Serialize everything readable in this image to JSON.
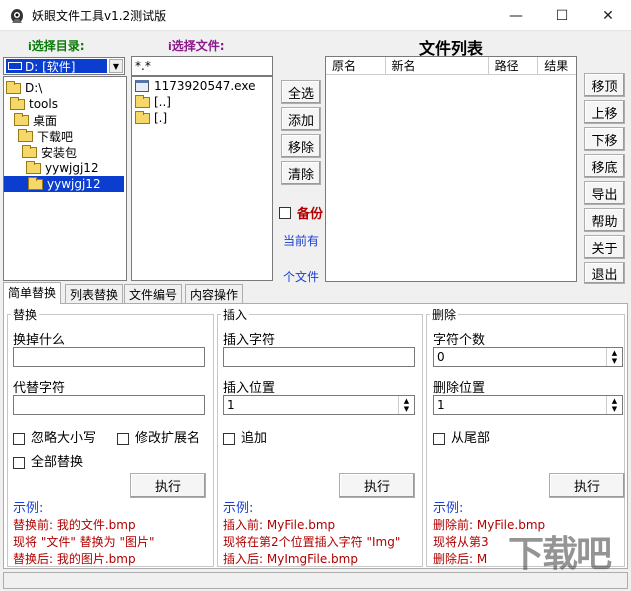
{
  "window": {
    "title": "妖眼文件工具v1.2测试版",
    "minimize": "—",
    "maximize": "☐",
    "close": "✕"
  },
  "labels": {
    "select_dir": "选择目录:",
    "select_file": "选择文件:",
    "file_list": "文件列表"
  },
  "drive": {
    "value": "D: [软件]"
  },
  "filter": {
    "value": "*.*"
  },
  "tree": [
    {
      "label": "D:\\",
      "indent": 0
    },
    {
      "label": "tools",
      "indent": 1
    },
    {
      "label": "桌面",
      "indent": 2
    },
    {
      "label": "下载吧",
      "indent": 3
    },
    {
      "label": "安装包",
      "indent": 4
    },
    {
      "label": "yywjgj12",
      "indent": 5
    },
    {
      "label": "yywjgj12",
      "indent": 6,
      "selected": true
    }
  ],
  "files": [
    {
      "label": "1173920547.exe",
      "type": "exe"
    },
    {
      "label": "[..]",
      "type": "folder"
    },
    {
      "label": "[.]",
      "type": "folder"
    }
  ],
  "mid_buttons": {
    "select_all": "全选",
    "add": "添加",
    "remove": "移除",
    "clear": "清除"
  },
  "backup": {
    "label": "备份",
    "checked": false
  },
  "current_info": {
    "line1": "当前有",
    "line2": "个文件"
  },
  "columns": [
    "原名",
    "新名",
    "路径",
    "结果"
  ],
  "right_buttons": {
    "top": "移顶",
    "up": "上移",
    "down": "下移",
    "bottom": "移底",
    "export": "导出",
    "help": "帮助",
    "about": "关于",
    "exit": "退出"
  },
  "tabs": [
    "简单替换",
    "列表替换",
    "文件编号",
    "内容操作"
  ],
  "replace": {
    "title": "替换",
    "find_label": "换掉什么",
    "find_value": "",
    "replace_label": "代替字符",
    "replace_value": "",
    "ignore_case": "忽略大小写",
    "change_ext": "修改扩展名",
    "replace_all": "全部替换",
    "run": "执行",
    "example_title": "示例:",
    "ex1": "替换前: 我的文件.bmp",
    "ex2": "现将 \"文件\" 替换为 \"图片\"",
    "ex3": "替换后: 我的图片.bmp"
  },
  "insert": {
    "title": "插入",
    "chars_label": "插入字符",
    "chars_value": "",
    "pos_label": "插入位置",
    "pos_value": "1",
    "append": "追加",
    "run": "执行",
    "example_title": "示例:",
    "ex1": "插入前: MyFile.bmp",
    "ex2": "现将在第2个位置插入字符 \"Img\"",
    "ex3": "插入后: MyImgFile.bmp"
  },
  "delete": {
    "title": "删除",
    "count_label": "字符个数",
    "count_value": "0",
    "pos_label": "删除位置",
    "pos_value": "1",
    "from_end": "从尾部",
    "run": "执行",
    "example_title": "示例:",
    "ex1": "删除前: MyFile.bmp",
    "ex2": "现将从第3",
    "ex3": "删除后: M"
  },
  "watermark": "下载吧"
}
